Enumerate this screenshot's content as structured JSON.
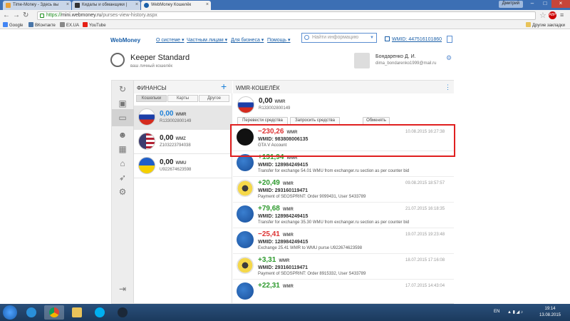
{
  "browser": {
    "tabs": [
      {
        "title": "Time-Money - Здесь вы"
      },
      {
        "title": "Кидалы и обманщики |"
      },
      {
        "title": "WebMoney Кошелёк"
      }
    ],
    "user_badge": "Дмитрий",
    "url_scheme": "https://",
    "url_host": "mini.webmoney.ru",
    "url_path": "/purses-view-history.aspx",
    "bookmarks": [
      "Google",
      "ВКонтакте",
      "EX.UA",
      "YouTube"
    ],
    "other_bookmarks": "Другие закладки"
  },
  "wm_header": {
    "logo": "WebMoney",
    "nav": [
      "О системе",
      "Частным лицам",
      "Для бизнеса",
      "Помощь"
    ],
    "search_placeholder": "Найти информацию",
    "wmid": "WMID: 447516101860"
  },
  "keeper": {
    "title": "Keeper Standard",
    "subtitle": "ваш личный кошелёк"
  },
  "user": {
    "name": "Бондаренко Д. И.",
    "email": "dima_bondarenko1999@mail.ru"
  },
  "finance": {
    "title": "ФИНАНСЫ",
    "subtabs": [
      "Кошельки",
      "Карты",
      "Другое"
    ],
    "purses": [
      {
        "amount": "0,00",
        "currency": "WMR",
        "number": "R133002800149",
        "flag": "ru"
      },
      {
        "amount": "0,00",
        "currency": "WMZ",
        "number": "Z103223794038",
        "flag": "us"
      },
      {
        "amount": "0,00",
        "currency": "WMU",
        "number": "U922674623598",
        "flag": "ua"
      }
    ]
  },
  "wallet": {
    "title": "WMR-КОШЕЛЁК",
    "balance": "0,00",
    "currency": "WMR",
    "number": "R133002800149",
    "actions": [
      "Перевести средства",
      "Запросить средства",
      "Обменять"
    ]
  },
  "transactions": [
    {
      "sum": "−230,26",
      "currency": "WMR",
      "date": "10.08.2015 16:27:38",
      "wmid": "WMID: 983808006135",
      "desc": "GTA V Account",
      "sign": "neg",
      "logo": "gta"
    },
    {
      "sum": "+131,94",
      "currency": "WMR",
      "date": "",
      "wmid": "WMID: 128984249415",
      "desc": "Transfer for exchange 54.01 WMU from exchanger.ru section as per counter bid",
      "sign": "pos",
      "logo": "exchanger"
    },
    {
      "sum": "+20,49",
      "currency": "WMR",
      "date": "09.08.2015 18:57:57",
      "wmid": "WMID: 293160119471",
      "desc": "Payment of SEOSPRINT: Order 9099431, User S433789",
      "sign": "pos",
      "logo": "seosprint"
    },
    {
      "sum": "+79,68",
      "currency": "WMR",
      "date": "21.07.2015 16:18:35",
      "wmid": "WMID: 128984249415",
      "desc": "Transfer for exchange 35.30 WMU from exchanger.ru section as per counter bid",
      "sign": "pos",
      "logo": "exchanger"
    },
    {
      "sum": "−25,41",
      "currency": "WMR",
      "date": "19.07.2015 19:23:48",
      "wmid": "WMID: 128984249415",
      "desc": "Exchange 25.41 WMR to WMU purse U922674623598",
      "sign": "neg",
      "logo": "exchanger"
    },
    {
      "sum": "+3,31",
      "currency": "WMR",
      "date": "18.07.2015 17:16:08",
      "wmid": "WMID: 293160119471",
      "desc": "Payment of SEOSPRINT: Order 8915332, User S433789",
      "sign": "pos",
      "logo": "seosprint"
    },
    {
      "sum": "+22,31",
      "currency": "WMR",
      "date": "17.07.2015 14:43:04",
      "wmid": "",
      "desc": "",
      "sign": "pos",
      "logo": "exchanger"
    }
  ],
  "taskbar": {
    "lang": "EN",
    "time": "19:14",
    "date": "13.08.2015"
  },
  "colors": {
    "positive": "#2e9a2e",
    "negative": "#d33333",
    "link": "#1a5fa8",
    "highlight": "#e02020"
  }
}
